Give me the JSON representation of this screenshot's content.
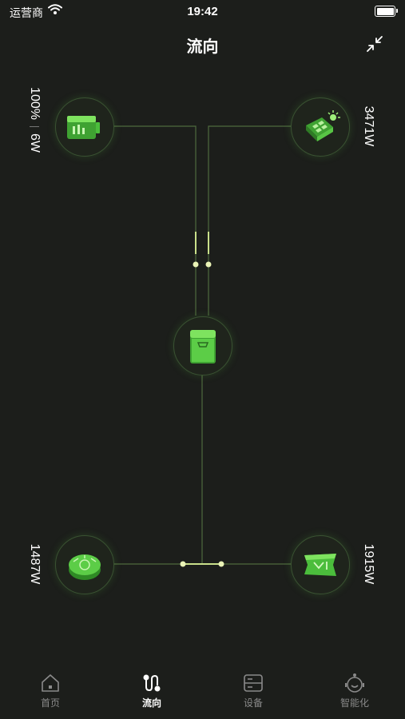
{
  "status_bar": {
    "carrier": "运营商",
    "time": "19:42"
  },
  "header": {
    "title": "流向"
  },
  "nodes": {
    "battery": {
      "percent": "100%",
      "power": "6W",
      "icon": "battery-icon"
    },
    "solar": {
      "power": "3471W",
      "icon": "solar-panel-icon"
    },
    "inverter": {
      "icon": "inverter-icon"
    },
    "generator": {
      "power": "1487W",
      "icon": "generator-icon"
    },
    "grid": {
      "power": "1915W",
      "icon": "grid-icon"
    }
  },
  "tabs": [
    {
      "label": "首页",
      "icon": "home-icon",
      "active": false
    },
    {
      "label": "流向",
      "icon": "flow-icon",
      "active": true
    },
    {
      "label": "设备",
      "icon": "device-icon",
      "active": false
    },
    {
      "label": "智能化",
      "icon": "robot-icon",
      "active": false
    }
  ],
  "colors": {
    "background": "#1c1e1b",
    "line": "#5c7a4a",
    "node_green": "#5fc84a",
    "dot": "#e9f2b0"
  }
}
